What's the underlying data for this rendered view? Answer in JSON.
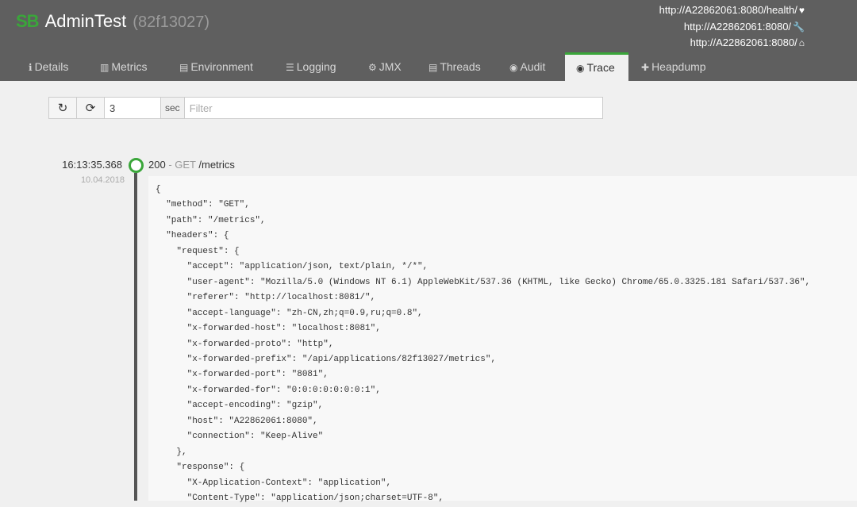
{
  "header": {
    "logo": "SB",
    "app_name": "AdminTest",
    "app_id": "(82f13027)",
    "urls": [
      {
        "text": "http://A22862061:8080/health/",
        "icon": "heartbeat-icon",
        "glyph": "♥"
      },
      {
        "text": "http://A22862061:8080/",
        "icon": "wrench-icon",
        "glyph": "🔧"
      },
      {
        "text": "http://A22862061:8080/",
        "icon": "home-icon",
        "glyph": "⌂"
      }
    ]
  },
  "tabs": [
    {
      "label": "Details",
      "icon": "info-icon",
      "glyph": "ℹ"
    },
    {
      "label": "Metrics",
      "icon": "chart-icon",
      "glyph": "▥"
    },
    {
      "label": "Environment",
      "icon": "table-icon",
      "glyph": "▤"
    },
    {
      "label": "Logging",
      "icon": "sliders-icon",
      "glyph": "☰"
    },
    {
      "label": "JMX",
      "icon": "cogs-icon",
      "glyph": "⚙"
    },
    {
      "label": "Threads",
      "icon": "list-icon",
      "glyph": "▤"
    },
    {
      "label": "Audit",
      "icon": "user-circle-icon",
      "glyph": "◉"
    },
    {
      "label": "Trace",
      "icon": "eye-icon",
      "glyph": "◉",
      "active": true
    },
    {
      "label": "Heapdump",
      "icon": "ambulance-icon",
      "glyph": "✚"
    }
  ],
  "toolbar": {
    "refresh_glyph": "↻",
    "autorefresh_glyph": "⟳",
    "interval_value": "3",
    "interval_unit": "sec",
    "filter_placeholder": "Filter"
  },
  "trace": {
    "time": "16:13:35.368",
    "date": "10.04.2018",
    "status": "200",
    "separator": " - ",
    "method": "GET",
    "path": "/metrics",
    "json_lines": [
      "{",
      "  \"method\": \"GET\",",
      "  \"path\": \"/metrics\",",
      "  \"headers\": {",
      "    \"request\": {",
      "      \"accept\": \"application/json, text/plain, */*\",",
      "      \"user-agent\": \"Mozilla/5.0 (Windows NT 6.1) AppleWebKit/537.36 (KHTML, like Gecko) Chrome/65.0.3325.181 Safari/537.36\",",
      "      \"referer\": \"http://localhost:8081/\",",
      "      \"accept-language\": \"zh-CN,zh;q=0.9,ru;q=0.8\",",
      "      \"x-forwarded-host\": \"localhost:8081\",",
      "      \"x-forwarded-proto\": \"http\",",
      "      \"x-forwarded-prefix\": \"/api/applications/82f13027/metrics\",",
      "      \"x-forwarded-port\": \"8081\",",
      "      \"x-forwarded-for\": \"0:0:0:0:0:0:0:1\",",
      "      \"accept-encoding\": \"gzip\",",
      "      \"host\": \"A22862061:8080\",",
      "      \"connection\": \"Keep-Alive\"",
      "    },",
      "    \"response\": {",
      "      \"X-Application-Context\": \"application\",",
      "      \"Content-Type\": \"application/json;charset=UTF-8\","
    ]
  }
}
